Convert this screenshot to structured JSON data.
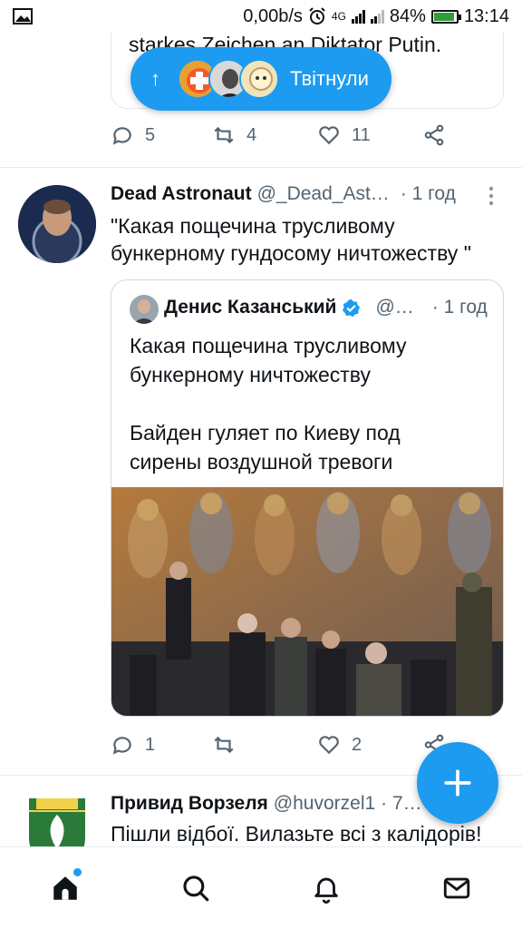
{
  "status_bar": {
    "network_speed": "0,00b/s",
    "alarm_icon": "alarm-clock-icon",
    "network_type": "4G",
    "battery_percent": "84%",
    "battery_level": 0.84,
    "time": "13:14"
  },
  "retweet_pill": {
    "label": "Твітнули"
  },
  "prev_tweet": {
    "text_fragment": "starkes Zeichen an Diktator Putin.",
    "replies": "5",
    "retweets": "4",
    "likes": "11"
  },
  "tweet": {
    "name": "Dead Astronaut",
    "handle": "@_Dead_Ast…",
    "time": "· 1 год",
    "text": "\"Какая пощечина трусливому бункерному гундосому ничтожеству \"",
    "quote": {
      "name": "Денис Казанський",
      "handle": "@…",
      "time": "· 1 год",
      "text_line1": "Какая пощечина трусливому бункерному ничтожеству",
      "text_line2": "Байден гуляет по Киеву под сирены воздушной тревоги"
    },
    "replies": "1",
    "likes": "2"
  },
  "next_tweet": {
    "name": "Привид Ворзеля",
    "handle": "@huvorzel1",
    "time": "· 7…",
    "text": "Пішли відбої. Вилазьте всі з калідорів!"
  },
  "colors": {
    "accent": "#1d9bf0",
    "text": "#0f1419",
    "muted": "#536471"
  }
}
